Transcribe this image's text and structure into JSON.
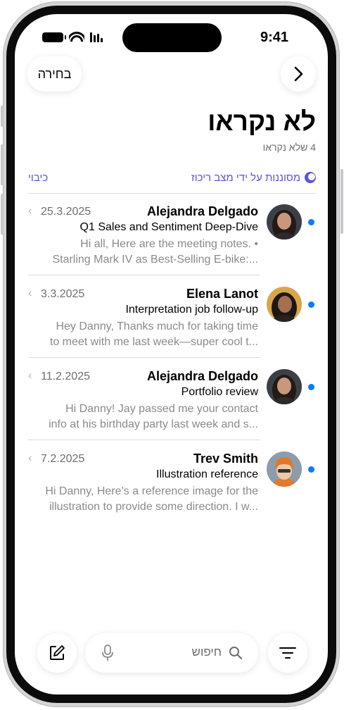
{
  "status_bar": {
    "time": "9:41"
  },
  "nav": {
    "select_label": "בחירה"
  },
  "header": {
    "title": "לא נקראו",
    "subtitle": "4 שלא נקראו"
  },
  "filter": {
    "focus_label": "מסוננות על ידי מצב ריכוז",
    "off_label": "כיבוי"
  },
  "mail": [
    {
      "sender": "Alejandra Delgado",
      "date": "25.3.2025",
      "subject": "Q1 Sales and Sentiment Deep-Dive",
      "preview_line1": "Hi all, Here are the meeting notes. •",
      "preview_line2": "Starling Mark IV as Best-Selling E-bike:..."
    },
    {
      "sender": "Elena Lanot",
      "date": "3.3.2025",
      "subject": "Interpretation job follow-up",
      "preview_line1": "Hey Danny, Thanks much for taking time",
      "preview_line2": "to meet with me last week—super cool t..."
    },
    {
      "sender": "Alejandra Delgado",
      "date": "11.2.2025",
      "subject": "Portfolio review",
      "preview_line1": "Hi Danny! Jay passed me your contact",
      "preview_line2": "info at his birthday party last week and s..."
    },
    {
      "sender": "Trev Smith",
      "date": "7.2.2025",
      "subject": "Illustration reference",
      "preview_line1": "Hi Danny, Here’s a reference image for the",
      "preview_line2": "illustration to provide some direction. I w..."
    }
  ],
  "toolbar": {
    "search_placeholder": "חיפוש"
  },
  "colors": {
    "accent": "#5856d6",
    "unread": "#0a7aff"
  }
}
